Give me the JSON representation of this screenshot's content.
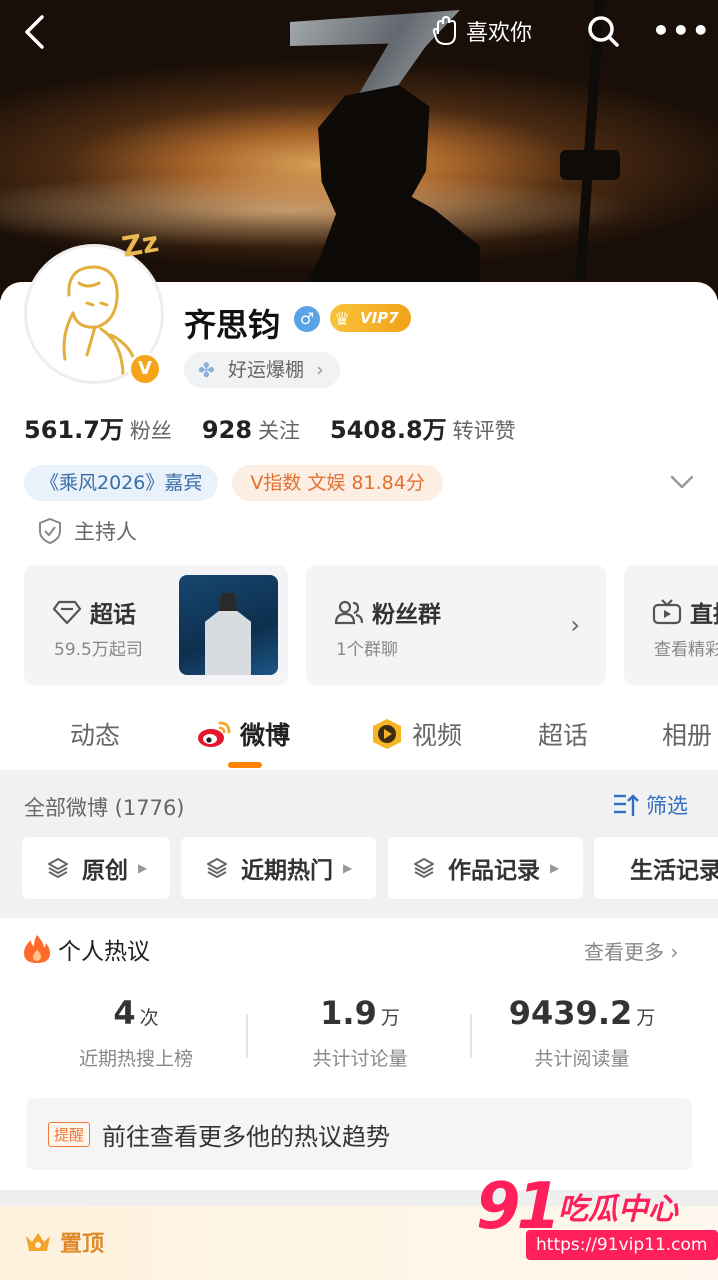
{
  "header": {
    "like_label": "喜欢你"
  },
  "profile": {
    "name": "齐思钧",
    "gender_symbol": "♂",
    "vip_label": "VIP7",
    "luck_chip": "好运爆棚",
    "verified_badge": "V",
    "avatar_zz": "Z​z",
    "stats": [
      {
        "value": "561.7万",
        "label": "粉丝"
      },
      {
        "value": "928",
        "label": "关注"
      },
      {
        "value": "5408.8万",
        "label": "转评赞"
      }
    ],
    "tags": {
      "guest": "《乘风2026》嘉宾",
      "v_index": "V指数 文娱 81.84分"
    },
    "role": "主持人"
  },
  "feature_cards": [
    {
      "title": "超话",
      "subtitle": "59.5万起司"
    },
    {
      "title": "粉丝群",
      "subtitle": "1个群聊"
    },
    {
      "title": "直播",
      "subtitle": "查看精彩"
    }
  ],
  "tabs": [
    {
      "label": "动态"
    },
    {
      "label": "微博"
    },
    {
      "label": "视频"
    },
    {
      "label": "超话"
    },
    {
      "label": "相册"
    }
  ],
  "filter": {
    "all_weibo": "全部微博 (1776)",
    "screen_label": "筛选",
    "chips": [
      "原创",
      "近期热门",
      "作品记录",
      "生活记录"
    ]
  },
  "hot": {
    "title": "个人热议",
    "see_more": "查看更多 ›",
    "stats": [
      {
        "value": "4",
        "unit": "次",
        "caption": "近期热搜上榜"
      },
      {
        "value": "1.9",
        "unit": "万",
        "caption": "共计讨论量"
      },
      {
        "value": "9439.2",
        "unit": "万",
        "caption": "共计阅读量"
      }
    ],
    "remind_tag": "提醒",
    "remind_text": "前往查看更多他的热议趋势"
  },
  "pinned": {
    "label": "置顶"
  },
  "watermark": {
    "number": "91",
    "name": "吃瓜中心",
    "url": "https://91vip11.com"
  },
  "colors": {
    "accent": "#ff8200",
    "link_blue": "#2f70c0",
    "tag_orange": "#e2712e"
  }
}
